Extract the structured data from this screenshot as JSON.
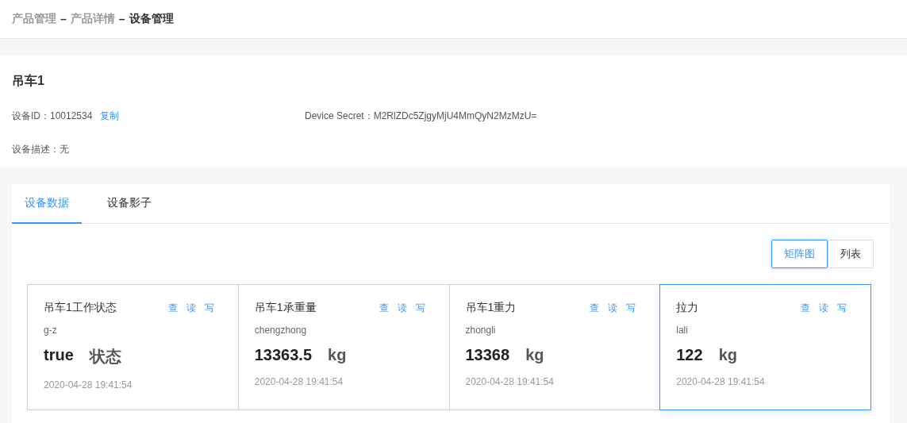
{
  "breadcrumb": {
    "items": [
      {
        "label": "产品管理",
        "current": false
      },
      {
        "label": "产品详情",
        "current": false
      },
      {
        "label": "设备管理",
        "current": true
      }
    ],
    "separator": "–"
  },
  "device": {
    "name": "吊车1",
    "id_label": "设备ID：10012534",
    "copy_link": "复制",
    "secret": "Device Secret：M2RlZDc5ZjgyMjU4MmQyN2MzMzU=",
    "description": "设备描述：无"
  },
  "tabs": [
    {
      "label": "设备数据",
      "selected": true
    },
    {
      "label": "设备影子",
      "selected": false
    }
  ],
  "view_toggle": [
    {
      "label": "矩阵图",
      "selected": true
    },
    {
      "label": "列表",
      "selected": false
    }
  ],
  "cards": [
    {
      "title": "吊车1工作状态",
      "actions": [
        "查",
        "读",
        "写"
      ],
      "key": "g-z",
      "value": "true",
      "unit": "状态",
      "time": "2020-04-28 19:41:54",
      "selected": false
    },
    {
      "title": "吊车1承重量",
      "actions": [
        "查",
        "读",
        "写"
      ],
      "key": "chengzhong",
      "value": "13363.5",
      "unit": "kg",
      "time": "2020-04-28 19:41:54",
      "selected": false
    },
    {
      "title": "吊车1重力",
      "actions": [
        "查",
        "读",
        "写"
      ],
      "key": "zhongli",
      "value": "13368",
      "unit": "kg",
      "time": "2020-04-28 19:41:54",
      "selected": false
    },
    {
      "title": "拉力",
      "actions": [
        "查",
        "读",
        "写"
      ],
      "key": "lali",
      "value": "122",
      "unit": "kg",
      "time": "2020-04-28 19:41:54",
      "selected": true
    }
  ]
}
